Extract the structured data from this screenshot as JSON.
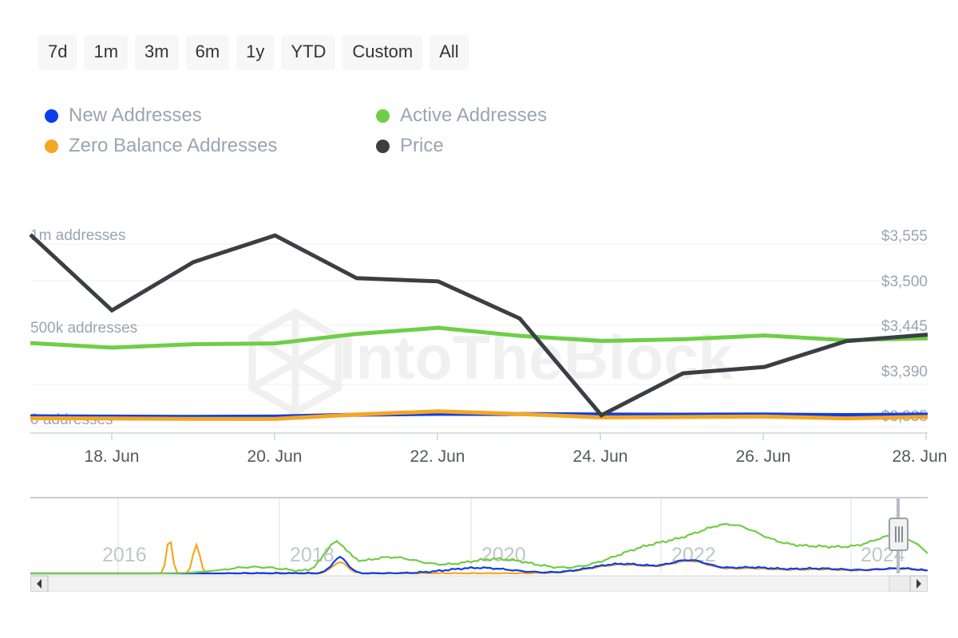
{
  "range_selector": {
    "buttons": [
      {
        "label": "7d",
        "selected": false
      },
      {
        "label": "1m",
        "selected": false
      },
      {
        "label": "3m",
        "selected": false
      },
      {
        "label": "6m",
        "selected": false
      },
      {
        "label": "1y",
        "selected": false
      },
      {
        "label": "YTD",
        "selected": false
      },
      {
        "label": "Custom",
        "selected": false
      },
      {
        "label": "All",
        "selected": false
      }
    ]
  },
  "legend": {
    "items": [
      {
        "label": "New Addresses",
        "color": "#0b3dea"
      },
      {
        "label": "Active Addresses",
        "color": "#6fce46"
      },
      {
        "label": "Zero Balance Addresses",
        "color": "#f5a623"
      },
      {
        "label": "Price",
        "color": "#3a3f45"
      }
    ]
  },
  "watermark": {
    "text": "IntoTheBlock"
  },
  "navigator": {
    "year_labels": [
      "2016",
      "2018",
      "2020",
      "2022",
      "2024"
    ],
    "scroll_left_arrow": "◀",
    "scroll_right_arrow": "▶"
  },
  "chart_data": {
    "type": "line",
    "title": "",
    "xlabel": "",
    "ylabel": "addresses",
    "grid": true,
    "legend_position": "top-left",
    "x": [
      "17. Jun",
      "18. Jun",
      "19. Jun",
      "20. Jun",
      "21. Jun",
      "22. Jun",
      "23. Jun",
      "24. Jun",
      "25. Jun",
      "26. Jun",
      "27. Jun",
      "28. Jun"
    ],
    "x_tick_labels": [
      "18. Jun",
      "20. Jun",
      "22. Jun",
      "24. Jun",
      "26. Jun",
      "28. Jun"
    ],
    "left_axis": {
      "label_suffix": "addresses",
      "tick_labels": [
        "1m addresses",
        "500k addresses",
        "0 addresses"
      ],
      "ticks": [
        1000000,
        500000,
        0
      ],
      "ylim": [
        0,
        1100000
      ]
    },
    "right_axis": {
      "tick_labels": [
        "$3,555",
        "$3,500",
        "$3,445",
        "$3,390",
        "$3,335"
      ],
      "ticks": [
        3555,
        3500,
        3445,
        3390,
        3335
      ],
      "ylim": [
        3310,
        3570
      ]
    },
    "series": [
      {
        "name": "New Addresses",
        "color": "#0b3dea",
        "axis": "left",
        "unit": "addresses",
        "values": [
          88000,
          86000,
          85000,
          86000,
          96000,
          101000,
          100000,
          97000,
          96000,
          97000,
          94000,
          97000
        ]
      },
      {
        "name": "Active Addresses",
        "color": "#6fce46",
        "axis": "left",
        "unit": "addresses",
        "values": [
          472000,
          448000,
          466000,
          470000,
          520000,
          552000,
          510000,
          483000,
          492000,
          512000,
          487000,
          497000
        ]
      },
      {
        "name": "Zero Balance Addresses",
        "color": "#f5a623",
        "axis": "left",
        "unit": "addresses",
        "values": [
          78000,
          76000,
          74000,
          74000,
          97000,
          114000,
          100000,
          82000,
          84000,
          87000,
          77000,
          85000
        ]
      },
      {
        "name": "Price",
        "color": "#3a3f45",
        "axis": "right",
        "unit": "USD",
        "values": [
          3556,
          3462,
          3522,
          3555,
          3502,
          3498,
          3452,
          3332,
          3384,
          3392,
          3424,
          3432
        ]
      }
    ]
  }
}
